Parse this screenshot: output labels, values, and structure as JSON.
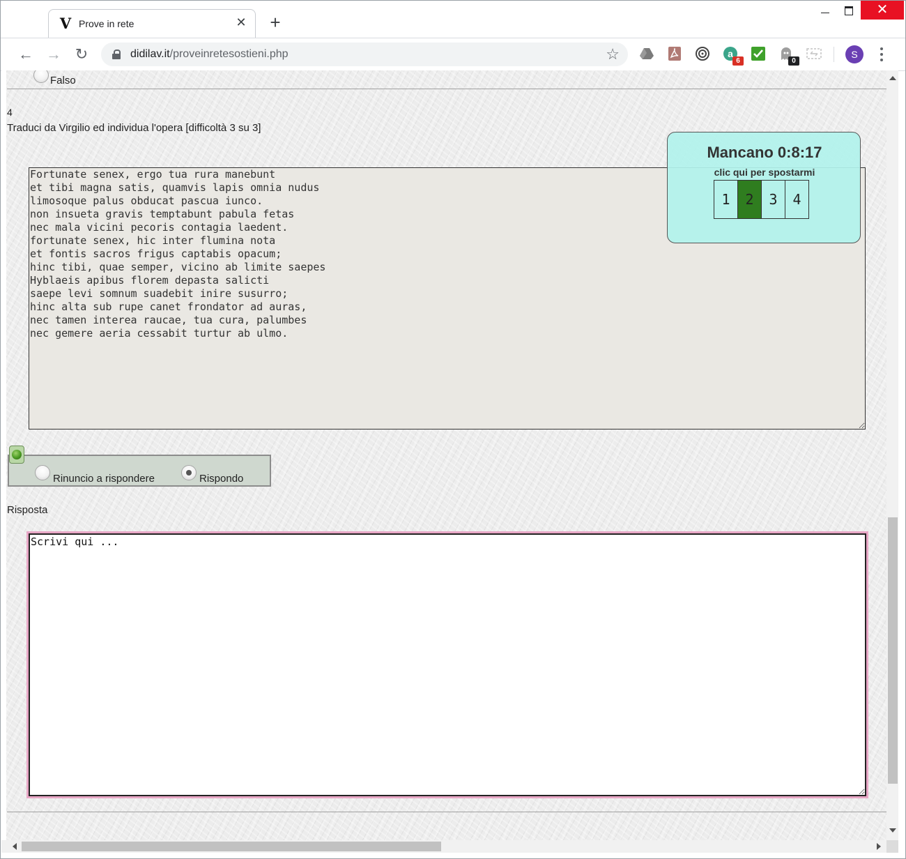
{
  "browser": {
    "tab_title": "Prove in rete",
    "tab_favicon_letter": "V",
    "url_host": "didilav.it",
    "url_path": "/proveinretesostieni.php",
    "extensions": [
      {
        "name": "google-drive-icon"
      },
      {
        "name": "pdf-icon"
      },
      {
        "name": "podcast-icon"
      },
      {
        "name": "a-extension-icon",
        "badge": "6",
        "badge_color": "#d93025"
      },
      {
        "name": "checkmark-extension-icon"
      },
      {
        "name": "ghost-extension-icon",
        "badge": "0",
        "badge_color": "#202124"
      },
      {
        "name": "grid-extension-icon"
      }
    ],
    "profile_initial": "S",
    "profile_color": "#6a3fb3"
  },
  "previous_question": {
    "option_false_label": "Falso"
  },
  "question": {
    "number": "4",
    "prompt": "Traduci da Virgilio ed individua l'opera [difficoltà 3 su 3]",
    "passage": "Fortunate senex, ergo tua rura manebunt\net tibi magna satis, quamvis lapis omnia nudus\nlimosoque palus obducat pascua iunco.\nnon insueta gravis temptabunt pabula fetas\nnec mala vicini pecoris contagia laedent.\nfortunate senex, hic inter flumina nota\net fontis sacros frigus captabis opacum;\nhinc tibi, quae semper, vicino ab limite saepes\nHyblaeis apibus florem depasta salicti\nsaepe levi somnum suadebit inire susurro;\nhinc alta sub rupe canet frondator ad auras,\nnec tamen interea raucae, tua cura, palumbes\nnec gemere aeria cessabit turtur ab ulmo.",
    "choices": {
      "renounce_label": "Rinuncio a rispondere",
      "answer_label": "Rispondo",
      "selected": "Rispondo"
    },
    "answer_heading": "Risposta",
    "answer_value": "Scrivi qui ..."
  },
  "timer": {
    "title": "Mancano 0:8:17",
    "hint": "clic qui per spostarmi",
    "questions": [
      "1",
      "2",
      "3",
      "4"
    ],
    "active_question": "2",
    "active_color": "#2f7d1f"
  }
}
